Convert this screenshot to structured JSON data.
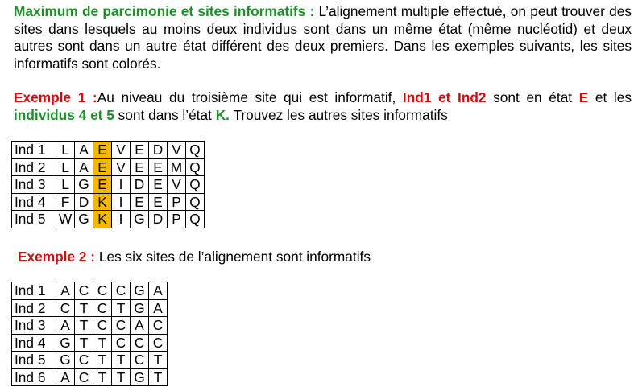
{
  "intro": {
    "title": "Maximum de parcimonie et sites informatifs :",
    "text": " L’alignement multiple effectué, on peut trouver des sites dans lesquels au moins deux individus sont dans un même état (même nucléotid) et deux autres sont dans un autre état différent des deux premiers. Dans les exemples suivants, les sites informatifs sont colorés."
  },
  "example1": {
    "label": "Exemple 1 :",
    "t1": "Au niveau du troisième site qui est informatif, ",
    "ind12": "Ind1 et Ind2",
    "t2": " sont en état ",
    "stateE": "E",
    "t3": " et les ",
    "ind45": "individus 4 et 5",
    "t4": " sont dans l’état ",
    "stateK": "K.",
    "t5": " Trouvez les autres sites informatifs",
    "highlight_color": "#f5b800",
    "table": [
      {
        "label": "Ind 1",
        "cells": [
          "L",
          "A",
          "E",
          "V",
          "E",
          "D",
          "V",
          "Q"
        ]
      },
      {
        "label": "Ind 2",
        "cells": [
          "L",
          "A",
          "E",
          "V",
          "E",
          "E",
          "M",
          "Q"
        ]
      },
      {
        "label": "Ind 3",
        "cells": [
          "L",
          "G",
          "E",
          "I",
          "D",
          "E",
          "V",
          "Q"
        ]
      },
      {
        "label": "Ind 4",
        "cells": [
          "F",
          "D",
          "K",
          "I",
          "E",
          "E",
          "P",
          "Q"
        ]
      },
      {
        "label": "Ind 5",
        "cells": [
          "W",
          "G",
          "K",
          "I",
          "G",
          "D",
          "P",
          "Q"
        ]
      }
    ]
  },
  "example2": {
    "label": "Exemple 2 :",
    "text": " Les six sites de l’alignement sont informatifs",
    "table": [
      {
        "label": "Ind 1",
        "cells": [
          "A",
          "C",
          "C",
          "C",
          "G",
          "A"
        ]
      },
      {
        "label": "Ind 2",
        "cells": [
          "C",
          "T",
          "C",
          "T",
          "G",
          "A"
        ]
      },
      {
        "label": "Ind 3",
        "cells": [
          "A",
          "T",
          "C",
          "C",
          "A",
          "C"
        ]
      },
      {
        "label": "Ind 4",
        "cells": [
          "G",
          "T",
          "T",
          "C",
          "C",
          "C"
        ]
      },
      {
        "label": "Ind 5",
        "cells": [
          "G",
          "C",
          "T",
          "T",
          "C",
          "T"
        ]
      },
      {
        "label": "Ind 6",
        "cells": [
          "A",
          "C",
          "T",
          "T",
          "G",
          "T"
        ]
      }
    ]
  }
}
